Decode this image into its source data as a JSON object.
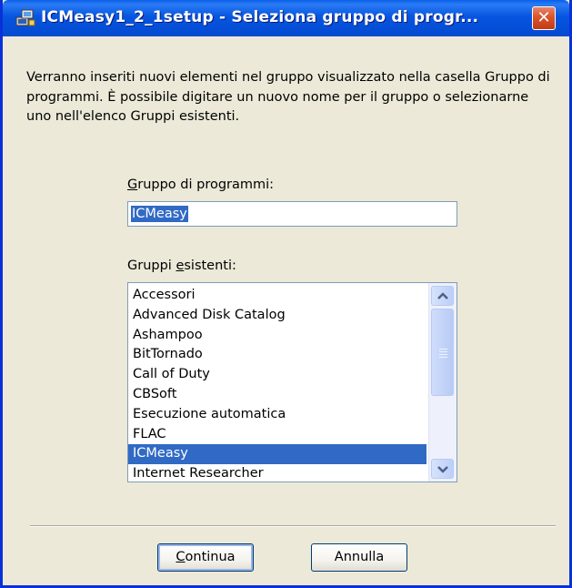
{
  "window": {
    "title": "ICMeasy1_2_1setup - Seleziona gruppo di progr...",
    "close_glyph": "✕",
    "app_icon": "setup-computer-icon"
  },
  "description": "Verranno inseriti nuovi elementi nel gruppo visualizzato nella casella Gruppo di programmi. È possibile digitare un nuovo nome per il gruppo o selezionarne uno nell'elenco Gruppi esistenti.",
  "group_field": {
    "label_accel": "G",
    "label_rest": "ruppo di programmi:",
    "value": "ICMeasy"
  },
  "existing_groups": {
    "label_pre": "Gruppi ",
    "label_accel": "e",
    "label_rest": "sistenti:",
    "items": [
      "Accessori",
      "Advanced Disk Catalog",
      "Ashampoo",
      "BitTornado",
      "Call of Duty",
      "CBSoft",
      "Esecuzione automatica",
      "FLAC",
      "ICMeasy",
      "Internet Researcher"
    ],
    "selected": "ICMeasy"
  },
  "buttons": {
    "continue_accel": "C",
    "continue_rest": "ontinua",
    "cancel": "Annulla"
  },
  "colors": {
    "titlebar": "#0655e0",
    "selection": "#316ac5",
    "dialog_bg": "#ece9d8",
    "close_button": "#d9532c"
  }
}
